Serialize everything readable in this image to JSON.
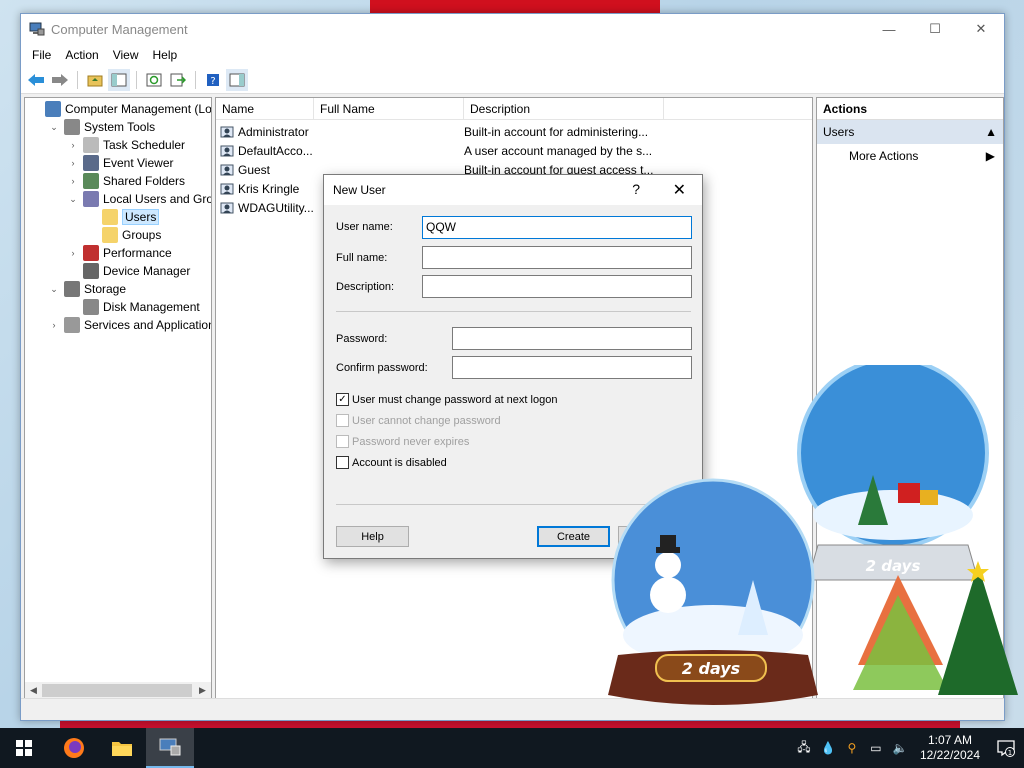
{
  "window": {
    "title": "Computer Management",
    "menu": [
      "File",
      "Action",
      "View",
      "Help"
    ]
  },
  "tree": {
    "items": [
      {
        "label": "Computer Management (Local",
        "level": 0,
        "expander": "",
        "icon": "computer-management-icon"
      },
      {
        "label": "System Tools",
        "level": 1,
        "expander": "⌄",
        "icon": "system-tools-icon"
      },
      {
        "label": "Task Scheduler",
        "level": 2,
        "expander": "›",
        "icon": "clock-icon"
      },
      {
        "label": "Event Viewer",
        "level": 2,
        "expander": "›",
        "icon": "event-viewer-icon"
      },
      {
        "label": "Shared Folders",
        "level": 2,
        "expander": "›",
        "icon": "shared-folders-icon"
      },
      {
        "label": "Local Users and Groups",
        "level": 2,
        "expander": "⌄",
        "icon": "users-groups-icon"
      },
      {
        "label": "Users",
        "level": 3,
        "expander": "",
        "icon": "folder-icon",
        "selected": true
      },
      {
        "label": "Groups",
        "level": 3,
        "expander": "",
        "icon": "folder-icon"
      },
      {
        "label": "Performance",
        "level": 2,
        "expander": "›",
        "icon": "performance-icon"
      },
      {
        "label": "Device Manager",
        "level": 2,
        "expander": "",
        "icon": "device-manager-icon"
      },
      {
        "label": "Storage",
        "level": 1,
        "expander": "⌄",
        "icon": "storage-icon"
      },
      {
        "label": "Disk Management",
        "level": 2,
        "expander": "",
        "icon": "disk-management-icon"
      },
      {
        "label": "Services and Applications",
        "level": 1,
        "expander": "›",
        "icon": "services-icon"
      }
    ]
  },
  "list": {
    "columns": [
      "Name",
      "Full Name",
      "Description"
    ],
    "rows": [
      {
        "name": "Administrator",
        "full_name": "",
        "description": "Built-in account for administering..."
      },
      {
        "name": "DefaultAcco...",
        "full_name": "",
        "description": "A user account managed by the s..."
      },
      {
        "name": "Guest",
        "full_name": "",
        "description": "Built-in account for guest access t..."
      },
      {
        "name": "Kris Kringle",
        "full_name": "",
        "description": ""
      },
      {
        "name": "WDAGUtility...",
        "full_name": "",
        "description": ""
      }
    ]
  },
  "actions": {
    "header": "Actions",
    "section": "Users",
    "more": "More Actions"
  },
  "dialog": {
    "title": "New User",
    "help_glyph": "?",
    "close_glyph": "✕",
    "username_label": "User name:",
    "username_value": "QQW",
    "fullname_label": "Full name:",
    "fullname_value": "",
    "description_label": "Description:",
    "description_value": "",
    "password_label": "Password:",
    "confirm_label": "Confirm password:",
    "checkboxes": [
      {
        "label": "User must change password at next logon",
        "checked": true,
        "enabled": true
      },
      {
        "label": "User cannot change password",
        "checked": false,
        "enabled": false
      },
      {
        "label": "Password never expires",
        "checked": false,
        "enabled": false
      },
      {
        "label": "Account is disabled",
        "checked": false,
        "enabled": true
      }
    ],
    "help_button": "Help",
    "create_button": "Create"
  },
  "decor": {
    "globe_text_1": "2 days",
    "globe_text_2": "2 days"
  },
  "taskbar": {
    "time": "1:07 AM",
    "date": "12/22/2024",
    "notification_count": "1"
  },
  "colors": {
    "accent": "#0078d7",
    "taskbar": "#101820",
    "selection": "#cde8ff"
  }
}
